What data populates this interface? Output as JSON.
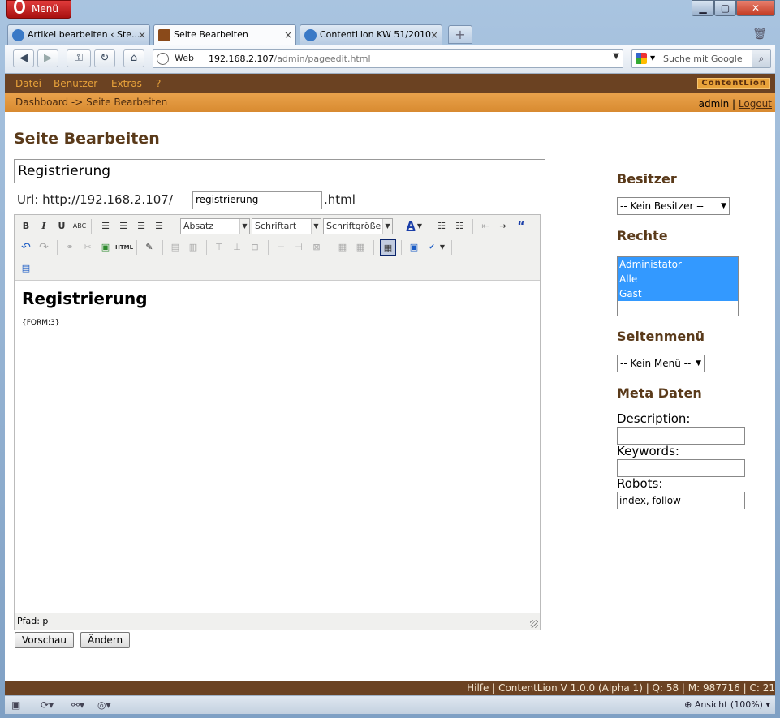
{
  "browser": {
    "menu_label": "Menü",
    "tabs": [
      {
        "label": "Artikel bearbeiten ‹ Ste...",
        "close": "×"
      },
      {
        "label": "Seite Bearbeiten",
        "close": "×"
      },
      {
        "label": "ContentLion KW 51/2010",
        "close": "×"
      }
    ],
    "newtab": "+",
    "address": {
      "scheme_label": "Web",
      "host": "192.168.2.107",
      "path": "/admin/pageedit.html"
    },
    "search_placeholder": "Suche mit Google",
    "zoom_label": "Ansicht (100%)"
  },
  "app": {
    "menu": [
      "Datei",
      "Benutzer",
      "Extras",
      "?"
    ],
    "brand": "ContentLion",
    "breadcrumb": "Dashboard -> Seite Bearbeiten",
    "user": "admin",
    "separator": "|",
    "logout": "Logout"
  },
  "page": {
    "title": "Seite Bearbeiten",
    "title_value": "Registrierung",
    "url_prefix": "Url: http://192.168.2.107/",
    "slug": "registrierung",
    "url_suffix": ".html"
  },
  "editor": {
    "format_select": "Absatz",
    "font_select": "Schriftart",
    "size_select": "Schriftgröße",
    "content_heading": "Registrierung",
    "content_text": "{FORM:3}",
    "path_label": "Pfad: p"
  },
  "buttons": {
    "preview": "Vorschau",
    "change": "Ändern"
  },
  "sidebar": {
    "owner_heading": "Besitzer",
    "owner_value": "-- Kein Besitzer --",
    "rights_heading": "Rechte",
    "rights_options": [
      "Administator",
      "Alle",
      "Gast"
    ],
    "menu_heading": "Seitenmenü",
    "menu_value": "-- Kein Menü --",
    "meta_heading": "Meta Daten",
    "description_label": "Description:",
    "description_value": "",
    "keywords_label": "Keywords:",
    "keywords_value": "",
    "robots_label": "Robots:",
    "robots_value": "index, follow"
  },
  "footer": {
    "text": "Hilfe | ContentLion V 1.0.0 (Alpha 1) | Q: 58 | M: 987716 | C: 21"
  }
}
